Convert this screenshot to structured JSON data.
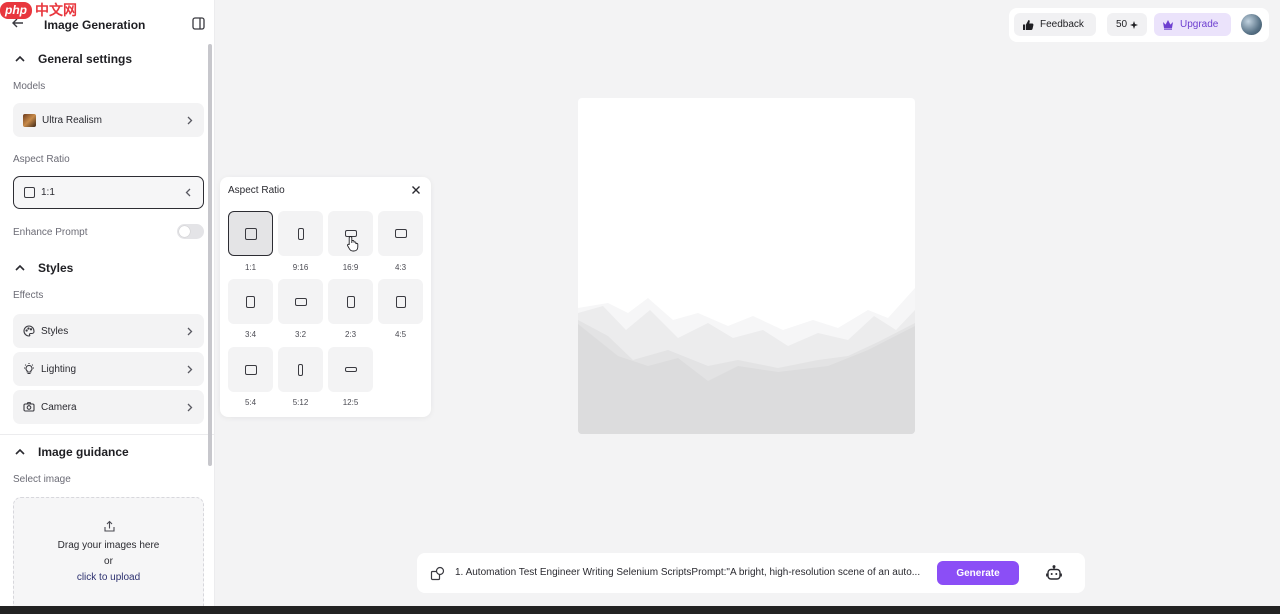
{
  "watermark": {
    "brand": "php",
    "suffix": "中文网"
  },
  "sidebar": {
    "title": "Image Generation",
    "general": {
      "heading": "General settings",
      "models_label": "Models",
      "model_value": "Ultra Realism",
      "aspect_label": "Aspect Ratio",
      "aspect_value": "1:1",
      "enhance_label": "Enhance Prompt",
      "enhance_on": false
    },
    "styles": {
      "heading": "Styles",
      "effects_label": "Effects",
      "items": [
        {
          "label": "Styles",
          "icon": "palette-icon"
        },
        {
          "label": "Lighting",
          "icon": "lightbulb-icon"
        },
        {
          "label": "Camera",
          "icon": "camera-icon"
        }
      ]
    },
    "guidance": {
      "heading": "Image guidance",
      "select_label": "Select image",
      "drop_text": "Drag your images here",
      "or_text": "or",
      "upload_link": "click to upload"
    }
  },
  "aspect_popup": {
    "title": "Aspect Ratio",
    "selected": "1:1",
    "options": [
      "1:1",
      "9:16",
      "16:9",
      "4:3",
      "3:4",
      "3:2",
      "2:3",
      "4:5",
      "5:4",
      "5:12",
      "12:5"
    ]
  },
  "topbar": {
    "feedback": "Feedback",
    "credits": "50",
    "upgrade": "Upgrade"
  },
  "prompt": {
    "text": "1. Automation Test Engineer Writing Selenium ScriptsPrompt:\"A bright, high-resolution scene of an auto...",
    "generate": "Generate"
  },
  "colors": {
    "accent": "#8b4ef6",
    "upgrade_bg": "#ebe3fb",
    "upgrade_fg": "#6d3fd0"
  }
}
